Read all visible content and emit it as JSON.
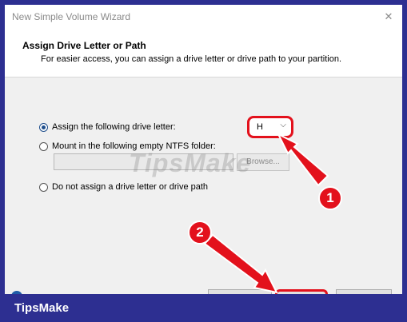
{
  "window": {
    "title": "New Simple Volume Wizard",
    "close_glyph": "✕"
  },
  "header": {
    "title": "Assign Drive Letter or Path",
    "subtitle": "For easier access, you can assign a drive letter or drive path to your partition."
  },
  "options": {
    "assign_letter": {
      "label": "Assign the following drive letter:",
      "selected": true
    },
    "mount_folder": {
      "label": "Mount in the following empty NTFS folder:",
      "selected": false
    },
    "no_assign": {
      "label": "Do not assign a drive letter or drive path",
      "selected": false
    }
  },
  "drive_select": {
    "value": "H",
    "chevron": "⌵"
  },
  "folder_input": {
    "value": ""
  },
  "browse_button": {
    "label": "Browse..."
  },
  "watermark": {
    "text": "TipsMake"
  },
  "annotations": {
    "badge_1": "1",
    "badge_2": "2",
    "color": "#e3111c"
  },
  "brand": {
    "text": "TipsMake",
    "color": "#2d2f91"
  },
  "icons": {
    "help": "help-circle-icon",
    "close": "close-icon",
    "chevron": "chevron-down-icon"
  }
}
